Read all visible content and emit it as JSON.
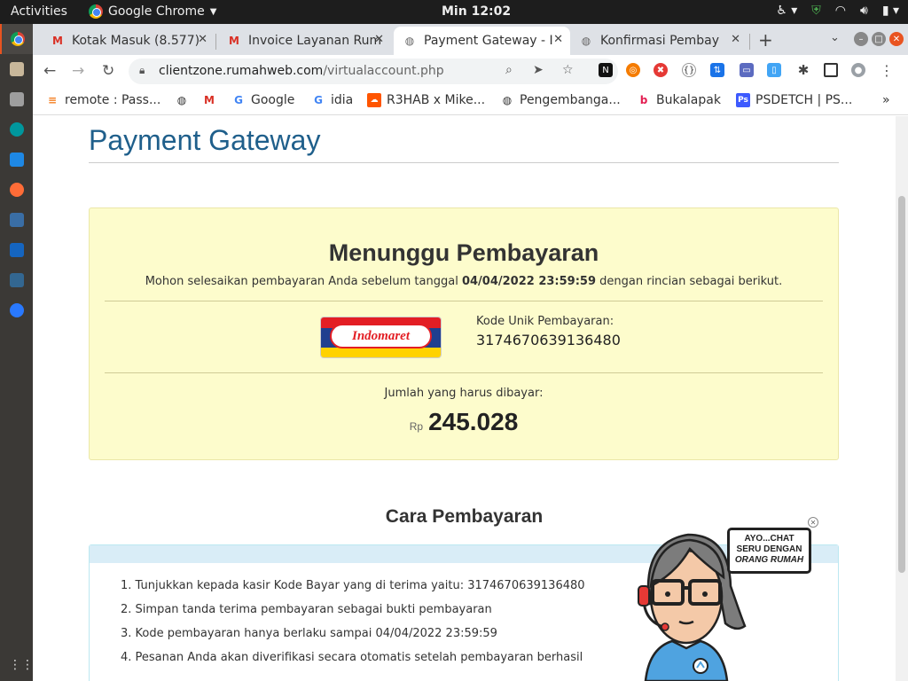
{
  "system_bar": {
    "activities": "Activities",
    "app_name": "Google Chrome",
    "clock": "Min 12:02"
  },
  "tabs": [
    {
      "title": "Kotak Masuk (8.577)",
      "icon": "gmail-icon",
      "active": false
    },
    {
      "title": "Invoice Layanan Rum",
      "icon": "gmail-icon",
      "active": false
    },
    {
      "title": "Payment Gateway - I",
      "icon": "globe-icon",
      "active": true
    },
    {
      "title": "Konfirmasi Pembay",
      "icon": "globe-icon",
      "active": false
    }
  ],
  "address_bar": {
    "domain": "clientzone.rumahweb.com",
    "path": "/virtualaccount.php"
  },
  "bookmarks": [
    {
      "label": "remote : Pass...",
      "icon": "stackoverflow-icon",
      "color": "#f48024"
    },
    {
      "label": "",
      "icon": "globe-icon",
      "color": "#333333"
    },
    {
      "label": "",
      "icon": "gmail-icon",
      "color": "#d93025"
    },
    {
      "label": "Google",
      "icon": "google-icon",
      "color": "#4285f4"
    },
    {
      "label": "idia",
      "icon": "google-icon",
      "color": "#4285f4"
    },
    {
      "label": "R3HAB x Mike...",
      "icon": "soundcloud-icon",
      "color": "#ff5500"
    },
    {
      "label": "Pengembanga...",
      "icon": "globe-icon",
      "color": "#333333"
    },
    {
      "label": "Bukalapak",
      "icon": "bukalapak-icon",
      "color": "#e31e52"
    },
    {
      "label": "PSDETCH | PS...",
      "icon": "psdetch-icon",
      "color": "#3d5afe"
    }
  ],
  "page": {
    "title": "Payment Gateway",
    "status_heading": "Menunggu Pembayaran",
    "notice_before": "Mohon selesaikan pembayaran Anda sebelum tanggal ",
    "deadline": "04/04/2022 23:59:59",
    "notice_after": " dengan rincian sebagai berikut.",
    "merchant_logo_text": "Indomaret",
    "code_label": "Kode Unik Pembayaran:",
    "code_value": "3174670639136480",
    "amount_label": "Jumlah yang harus dibayar:",
    "currency": "Rp",
    "amount": "245.028",
    "instructions_title": "Cara Pembayaran",
    "instructions": [
      "1. Tunjukkan kepada kasir Kode Bayar yang di terima yaitu: 3174670639136480",
      "2. Simpan tanda terima pembayaran sebagai bukti pembayaran",
      "3. Kode pembayaran hanya berlaku sampai 04/04/2022 23:59:59",
      "4. Pesanan Anda akan diverifikasi secara otomatis setelah pembayaran berhasil"
    ]
  },
  "chat_widget": {
    "line1": "AYO...CHAT",
    "line2": "SERU DENGAN",
    "line3": "ORANG RUMAH"
  },
  "colors": {
    "accent_title": "#1f5f8b",
    "wait_box_bg": "#fdfccc",
    "info_header": "#d9edf7"
  }
}
